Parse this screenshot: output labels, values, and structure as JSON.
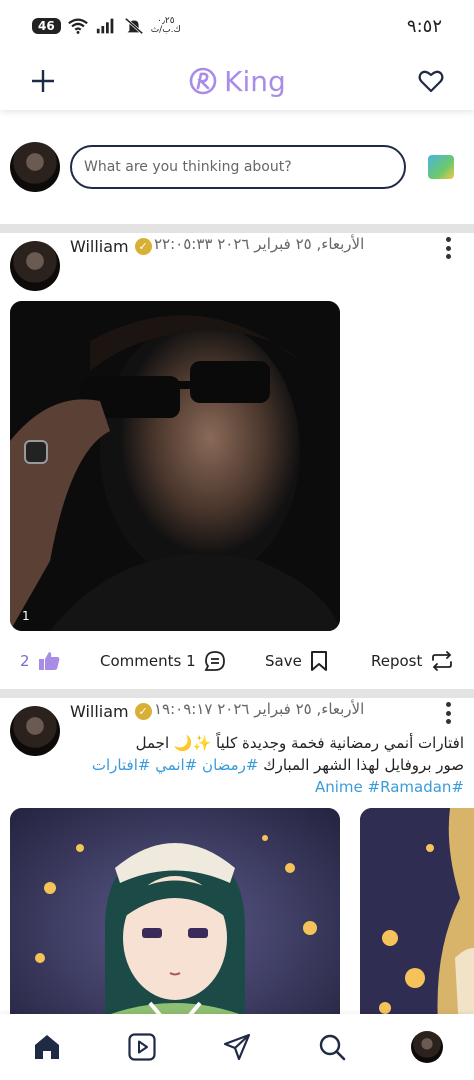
{
  "status_bar": {
    "network": "46",
    "speed_value": "٠٫٢٥",
    "speed_unit": "ك.ب/ث",
    "time": "٩:٥٢",
    "icons": [
      "wifi-icon",
      "signal-icon",
      "mute-icon"
    ]
  },
  "header": {
    "brand_name": "King",
    "brand_color": "#a98ce8",
    "icons": [
      "add-icon",
      "heart-icon"
    ]
  },
  "composer": {
    "placeholder": "What are you thinking about?",
    "icon": "photo-icon"
  },
  "posts": [
    {
      "author": "William",
      "verified": true,
      "date": "الأربعاء, ٢٥ فبراير ٢٠٢٦ ٢٢:٠٥:٣٣",
      "media_count": "1",
      "likes": "2",
      "comments_label": "Comments 1",
      "save_label": "Save",
      "repost_label": "Repost"
    },
    {
      "author": "William",
      "verified": true,
      "date": "الأربعاء, ٢٥ فبراير ٢٠٢٦ ١٩:٠٩:١٧",
      "caption_line1": "افتارات أنمي رمضانية فخمة وجديدة كلياً ✨🌙 اجمل",
      "caption_line2_text": "صور بروفايل لهذا الشهر المبارك ",
      "caption_line2_tags": "#رمضان #انمي #افتارات",
      "caption_line3_tags": "#Anime #Ramadan"
    }
  ],
  "bottom_nav": {
    "items": [
      "home-icon",
      "video-icon",
      "send-icon",
      "search-icon",
      "profile-avatar"
    ],
    "active": "home-icon",
    "accent": "#1f2a44"
  }
}
